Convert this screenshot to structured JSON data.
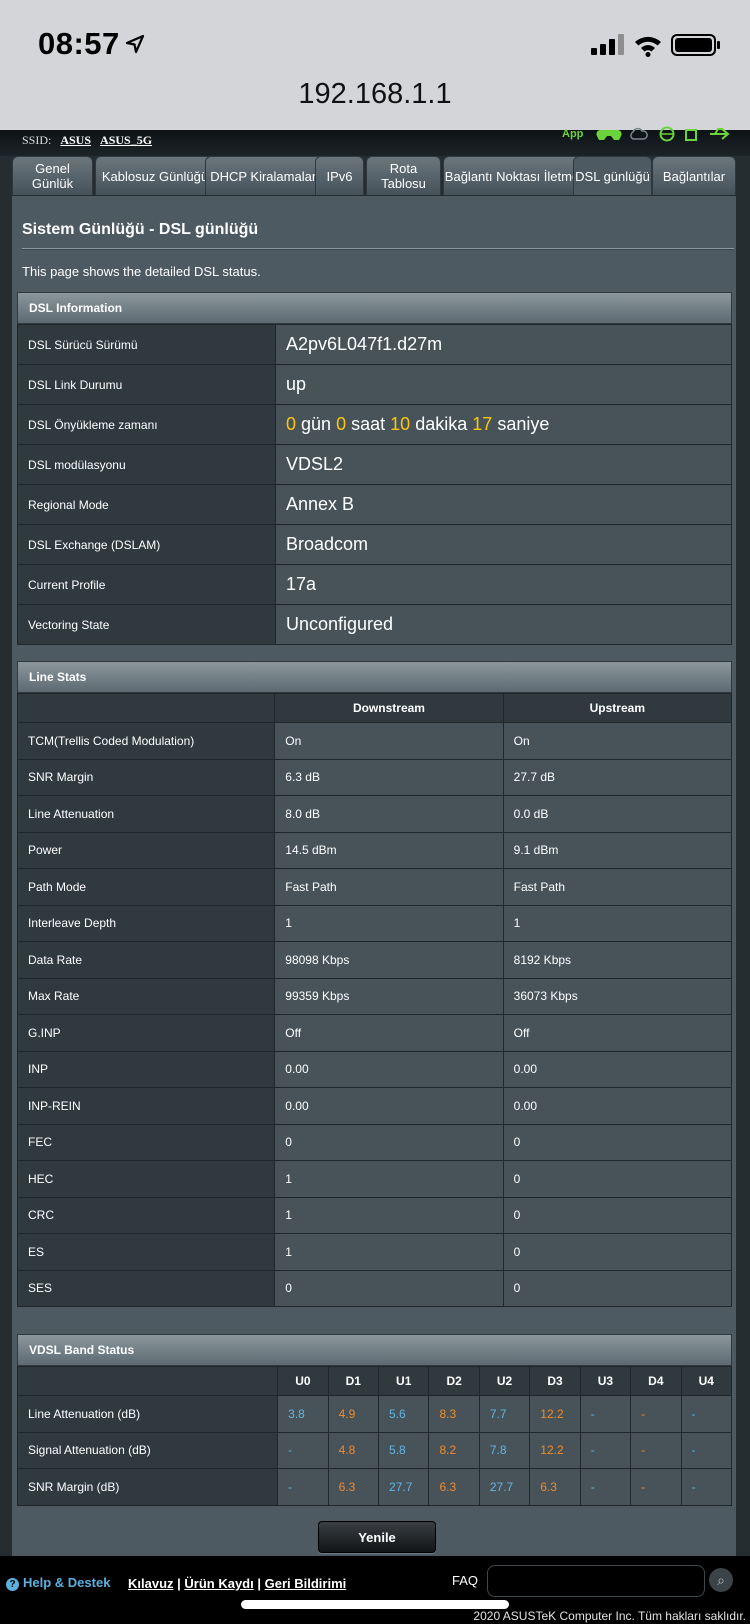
{
  "status_bar": {
    "time": "08:57"
  },
  "browser": {
    "url": "192.168.1.1"
  },
  "header": {
    "ssid_label": "SSID:",
    "ssid_1": "ASUS",
    "ssid_2": "ASUS_5G",
    "app_label": "App"
  },
  "tabs": [
    {
      "label": "Genel Günlük"
    },
    {
      "label": "Kablosuz Günlüğü"
    },
    {
      "label": "DHCP Kiralamaları"
    },
    {
      "label": "IPv6"
    },
    {
      "label": "Rota Tablosu"
    },
    {
      "label": "Bağlantı Noktası İletme"
    },
    {
      "label": "DSL günlüğü"
    },
    {
      "label": "Bağlantılar"
    }
  ],
  "page": {
    "title": "Sistem Günlüğü - DSL günlüğü",
    "description": "This page shows the detailed DSL status."
  },
  "dsl_info": {
    "heading": "DSL Information",
    "rows": [
      {
        "label": "DSL Sürücü Sürümü",
        "value": "A2pv6L047f1.d27m"
      },
      {
        "label": "DSL Link Durumu",
        "value": "up"
      },
      {
        "label": "DSL Önyükleme zamanı",
        "value": ""
      },
      {
        "label": "DSL modülasyonu",
        "value": "VDSL2"
      },
      {
        "label": "Regional Mode",
        "value": "Annex B"
      },
      {
        "label": "DSL Exchange (DSLAM)",
        "value": "Broadcom"
      },
      {
        "label": "Current Profile",
        "value": "17a"
      },
      {
        "label": "Vectoring State",
        "value": "Unconfigured"
      }
    ],
    "uptime": {
      "days": "0",
      "days_unit": "gün",
      "hours": "0",
      "hours_unit": "saat",
      "minutes": "10",
      "minutes_unit": "dakika",
      "seconds": "17",
      "seconds_unit": "saniye"
    }
  },
  "line_stats": {
    "heading": "Line Stats",
    "col_downstream": "Downstream",
    "col_upstream": "Upstream",
    "rows": [
      {
        "label": "TCM(Trellis Coded Modulation)",
        "down": "On",
        "up": "On"
      },
      {
        "label": "SNR Margin",
        "down": "6.3 dB",
        "up": "27.7 dB"
      },
      {
        "label": "Line Attenuation",
        "down": "8.0 dB",
        "up": "0.0 dB"
      },
      {
        "label": "Power",
        "down": "14.5 dBm",
        "up": "9.1 dBm"
      },
      {
        "label": "Path Mode",
        "down": "Fast Path",
        "up": "Fast Path"
      },
      {
        "label": "Interleave Depth",
        "down": "1",
        "up": "1"
      },
      {
        "label": "Data Rate",
        "down": "98098 Kbps",
        "up": "8192 Kbps"
      },
      {
        "label": "Max Rate",
        "down": "99359 Kbps",
        "up": "36073 Kbps"
      },
      {
        "label": "G.INP",
        "down": "Off",
        "up": "Off"
      },
      {
        "label": "INP",
        "down": "0.00",
        "up": "0.00"
      },
      {
        "label": "INP-REIN",
        "down": "0.00",
        "up": "0.00"
      },
      {
        "label": "FEC",
        "down": "0",
        "up": "0"
      },
      {
        "label": "HEC",
        "down": "1",
        "up": "0"
      },
      {
        "label": "CRC",
        "down": "1",
        "up": "0"
      },
      {
        "label": "ES",
        "down": "1",
        "up": "0"
      },
      {
        "label": "SES",
        "down": "0",
        "up": "0"
      }
    ]
  },
  "vdsl_band": {
    "heading": "VDSL Band Status",
    "columns": [
      "U0",
      "D1",
      "U1",
      "D2",
      "U2",
      "D3",
      "U3",
      "D4",
      "U4"
    ],
    "rows": [
      {
        "label": "Line Attenuation (dB)",
        "values": [
          "3.8",
          "4.9",
          "5.6",
          "8.3",
          "7.7",
          "12.2",
          "-",
          "-",
          "-"
        ]
      },
      {
        "label": "Signal Attenuation (dB)",
        "values": [
          "-",
          "4.8",
          "5.8",
          "8.2",
          "7.8",
          "12.2",
          "-",
          "-",
          "-"
        ]
      },
      {
        "label": "SNR Margin (dB)",
        "values": [
          "-",
          "6.3",
          "27.7",
          "6.3",
          "27.7",
          "6.3",
          "-",
          "-",
          "-"
        ]
      }
    ],
    "up_color": "#5eb6e6",
    "down_color": "#f08a2a"
  },
  "refresh_button": "Yenile",
  "footer": {
    "help": "Help & Destek",
    "link_manual": "Kılavuz",
    "link_register": "Ürün Kaydı",
    "link_feedback": "Geri Bildirimi",
    "faq": "FAQ",
    "copyright": "2020 ASUSTeK Computer Inc. Tüm hakları saklıdır."
  }
}
